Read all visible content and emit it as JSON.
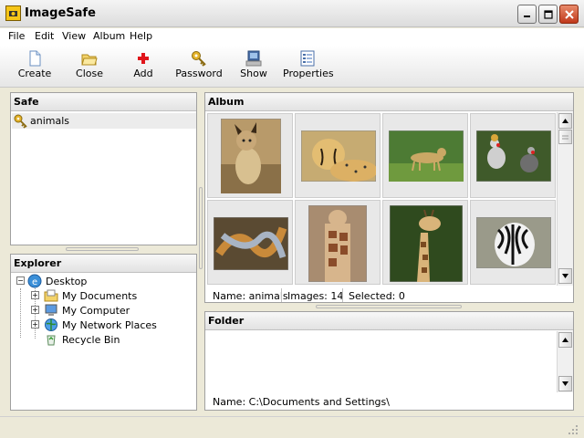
{
  "window": {
    "title": "ImageSafe"
  },
  "menu": [
    "File",
    "Edit",
    "View",
    "Album",
    "Help"
  ],
  "toolbar": {
    "create": "Create",
    "close": "Close",
    "add": "Add",
    "password": "Password",
    "show": "Show",
    "properties": "Properties"
  },
  "safe": {
    "title": "Safe",
    "items": [
      {
        "label": "animals",
        "icon": "key-icon",
        "selected": true
      }
    ]
  },
  "explorer": {
    "title": "Explorer",
    "root": "Desktop",
    "children": [
      "My Documents",
      "My Computer",
      "My Network Places",
      "Recycle Bin"
    ]
  },
  "album": {
    "title": "Album",
    "thumbnails": [
      "caracal",
      "cheetah",
      "cheetah-grass",
      "crowned-cranes",
      "snake",
      "giraffe-calf",
      "giraffe",
      "zebra"
    ],
    "status_name": "Name: animals",
    "status_images": "Images: 14",
    "status_selected": "Selected: 0"
  },
  "folder": {
    "title": "Folder",
    "status_name": "Name: C:\\Documents and Settings\\"
  },
  "colors": {
    "accent": "#2f6bc2",
    "selection": "#ececec",
    "panel_header": "#e6e6e6"
  }
}
